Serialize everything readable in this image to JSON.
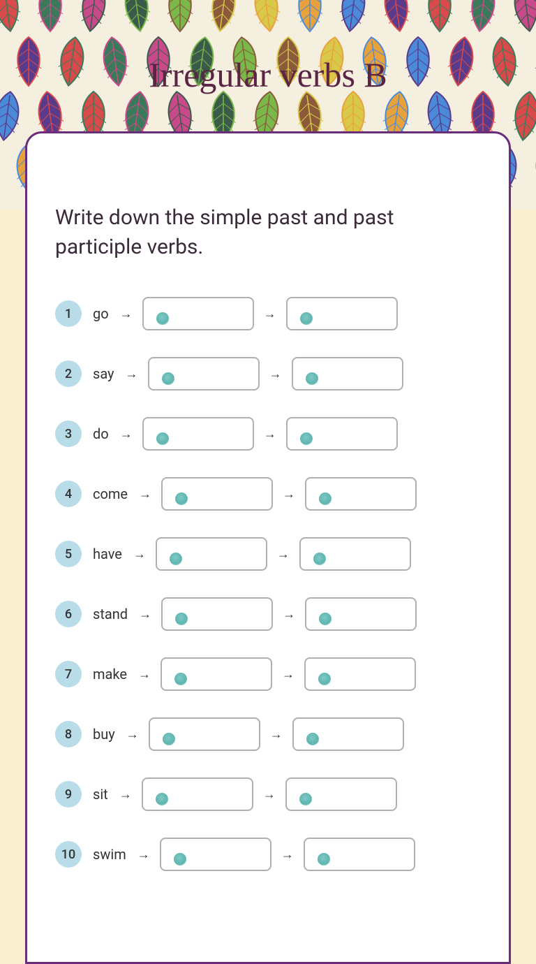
{
  "title": "Irregular verbs B",
  "instructions": "Write down the simple past and past participle verbs.",
  "verbs": [
    {
      "num": "1",
      "base": "go"
    },
    {
      "num": "2",
      "base": "say"
    },
    {
      "num": "3",
      "base": "do"
    },
    {
      "num": "4",
      "base": "come"
    },
    {
      "num": "5",
      "base": "have"
    },
    {
      "num": "6",
      "base": "stand"
    },
    {
      "num": "7",
      "base": "make"
    },
    {
      "num": "8",
      "base": "buy"
    },
    {
      "num": "9",
      "base": "sit"
    },
    {
      "num": "10",
      "base": "swim"
    }
  ],
  "leaf_colors": [
    "#d94a4a",
    "#e8a23c",
    "#7ab84a",
    "#3a7a5a",
    "#4a8ad9",
    "#8a5a3a",
    "#c94a8a",
    "#5a3a8a",
    "#d9c94a",
    "#3a5a4a"
  ]
}
